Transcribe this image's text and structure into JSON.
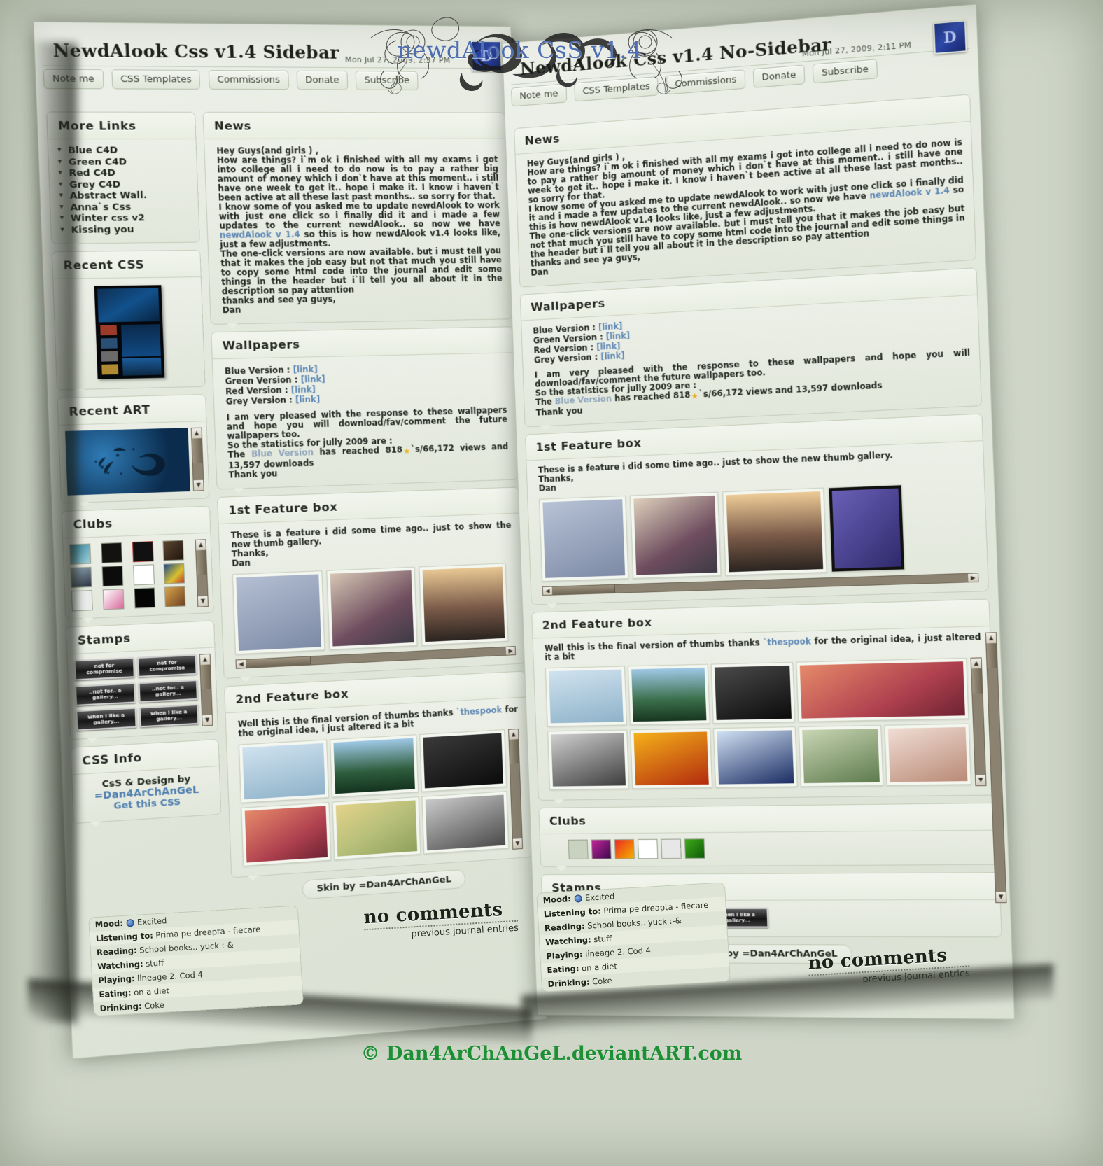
{
  "banner": {
    "title": "newdAlook CsS v1.4"
  },
  "footer": {
    "credit": "© Dan4ArChAnGeL.deviantART.com"
  },
  "left_page": {
    "title": "NewdAlook Css v1.4 Sidebar",
    "date": "Mon Jul 27, 2009, 2:37 PM",
    "avatar_letter": "D",
    "nav": [
      "Note me",
      "CSS Templates",
      "Commissions",
      "Donate",
      "Subscribe"
    ],
    "sidebar": [
      {
        "heading": "More Links",
        "links": [
          "Blue C4D",
          "Green C4D",
          "Red C4D",
          "Grey C4D",
          "Abstract Wall.",
          "Anna`s Css",
          "Winter css v2",
          "Kissing you"
        ]
      },
      {
        "heading": "Recent CSS"
      },
      {
        "heading": "Recent ART"
      },
      {
        "heading": "Clubs"
      },
      {
        "heading": "Stamps"
      },
      {
        "heading": "CSS Info",
        "line1": "CsS & Design by",
        "line2": "=Dan4ArChAnGeL",
        "line3": "Get this CSS"
      }
    ]
  },
  "right_page": {
    "title": "NewdAlook Css v1.4 No-Sidebar",
    "date": "Mon Jul 27, 2009, 2:11 PM",
    "avatar_letter": "D",
    "nav": [
      "Note me",
      "CSS Templates",
      "Commissions",
      "Donate",
      "Subscribe"
    ]
  },
  "modules": {
    "news": {
      "heading": "News",
      "greeting": "Hey Guys(and girls ) ,",
      "p1": "How are things? i`m ok i finished with all my exams  i got into college  all i need to do now is to pay a rather big amount of money which i don`t have at this moment.. i still have one week to get it.. hope i make it. I know i haven`t been active at all these last past months.. so sorry for that.",
      "p2": "I know some of you asked me to update newdAlook to work with just one click so i finally did it  and i made a few updates to the current newdAlook.. so now we have",
      "link_text": "newdAlook v 1.4",
      "p3": "so this is how newdAlook v1.4 looks like, just a few adjustments.",
      "p4": "The one-click versions are now available. but i must tell you that it makes the job easy but not that much  you still have to copy some html code into the journal and edit some things in the header but i`ll tell you all about it in the description so pay attention",
      "signoff1": "thanks and see ya guys,",
      "signoff2": "Dan"
    },
    "wallpapers": {
      "heading": "Wallpapers",
      "rows": [
        {
          "label": "Blue Version :",
          "link": "[link]"
        },
        {
          "label": "Green Version :",
          "link": "[link]"
        },
        {
          "label": "Red Version :",
          "link": "[link]"
        },
        {
          "label": "Grey Version :",
          "link": "[link]"
        }
      ],
      "p1": "I am very pleased with the response to these wallpapers and hope you will download/fav/comment the future wallpapers too.",
      "p2": "So the statistics for jully 2009 are :",
      "stat_pre": "The",
      "stat_link": "Blue Version",
      "stat_mid": "has reached",
      "stat_favs": "818",
      "stat_rest": "`s/66,172 views and 13,597 downloads",
      "thanks": "Thank you"
    },
    "feature1": {
      "heading": "1st Feature box",
      "line1": "These is a feature i did some time ago.. just to show the new thumb gallery.",
      "line2": "Thanks,",
      "line3": "Dan"
    },
    "feature2": {
      "heading": "2nd Feature box",
      "line1": "Well this is the final version of thumbs  thanks",
      "user": "`thespook",
      "line2": "for the original idea, i just altered it a bit"
    },
    "clubs": {
      "heading": "Clubs"
    },
    "stamps": {
      "heading": "Stamps",
      "label": "when i like a gallery..."
    },
    "stamps_left": {
      "heading": "Stamps",
      "label1": "not for compromise",
      "label2": "..not for.. a gallery...",
      "label3": "when i like a gallery..."
    },
    "skin_by": "Skin by =Dan4ArChAnGeL",
    "no_comments": "no comments",
    "previous_entries": "previous journal entries"
  },
  "mood": {
    "rows": [
      {
        "label": "Mood:",
        "value": "Excited"
      },
      {
        "label": "Listening to:",
        "value": "Prima pe dreapta - fiecare"
      },
      {
        "label": "Reading:",
        "value": "School books.. yuck :-&"
      },
      {
        "label": "Watching:",
        "value": "stuff"
      },
      {
        "label": "Playing:",
        "value": "lineage 2. Cod 4"
      },
      {
        "label": "Eating:",
        "value": "on a diet"
      },
      {
        "label": "Drinking:",
        "value": "Coke"
      }
    ]
  },
  "colors": {
    "page_bg": "#e3e8dd",
    "accent_link": "#5d87b5",
    "banner_title": "#4e6fb5",
    "footer_green": "#1f8f35",
    "scroll": "#8b8272"
  }
}
